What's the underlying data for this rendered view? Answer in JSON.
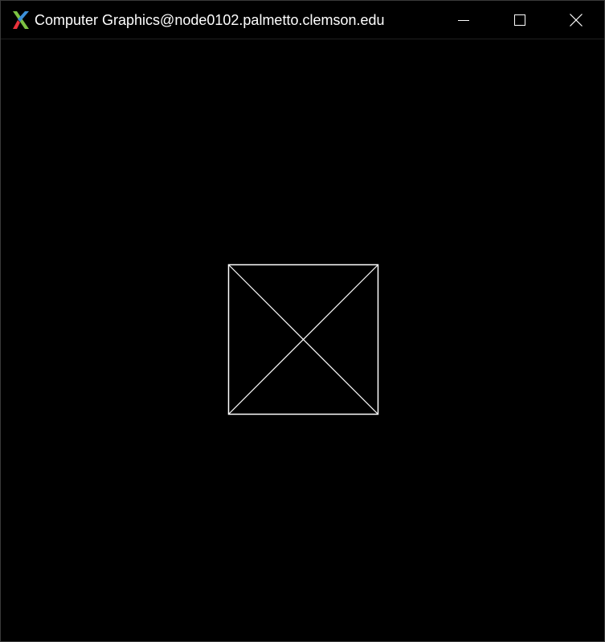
{
  "window": {
    "title": "Computer Graphics@node0102.palmetto.clemson.edu",
    "icon": "x11-icon",
    "controls": {
      "minimize_icon": "minimize-icon",
      "maximize_icon": "maximize-icon",
      "close_icon": "close-icon"
    }
  },
  "colors": {
    "background": "#000000",
    "title_text": "#ffffff",
    "stroke": "#ffffff",
    "x_icon_green": "#7cc243",
    "x_icon_red": "#e8323c",
    "x_icon_blue": "#3b8fd9"
  },
  "scene": {
    "shape": "square with both diagonals",
    "stroke_color": "#ffffff"
  }
}
